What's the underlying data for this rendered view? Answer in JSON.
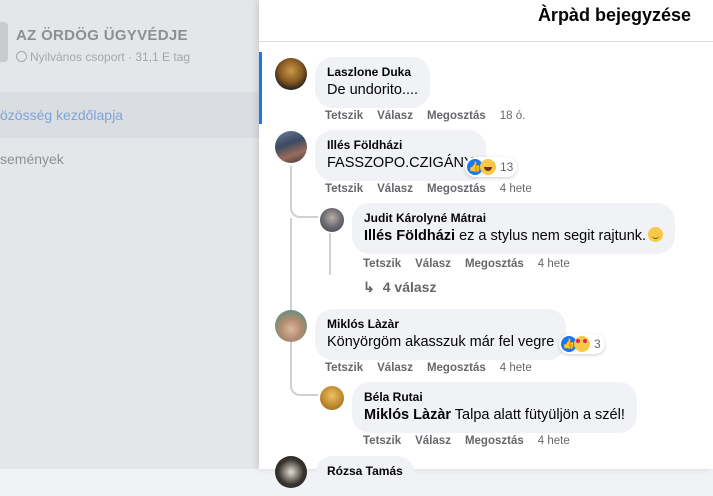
{
  "sidebar": {
    "group_name": "AZ ÖRDÖG ÜGYVÉDJE",
    "group_meta": "Nyilvános csoport · 31,1 E tag",
    "items": [
      {
        "label": "özösség kezdőlapja"
      },
      {
        "label": "semények"
      }
    ]
  },
  "panel": {
    "title": "Àrpàd bejegyzése"
  },
  "actions": {
    "like": "Tetszik",
    "reply": "Válasz",
    "share": "Megosztás"
  },
  "comments": [
    {
      "author": "Laszlone Duka",
      "text": "De undorito....",
      "time": "18 ó."
    },
    {
      "author": "Illés Földházi",
      "text": "FASSZOPO.CZIGÁNY",
      "time": "4 hete",
      "reaction_count": "13",
      "reactions": [
        "like-icon",
        "haha-icon"
      ]
    },
    {
      "author": "Judit Károlyné Mátrai",
      "mention": "Illés Földházi",
      "text": " ez a stylus nem segit rajtunk.",
      "time": "4 hete",
      "emoji": "upside-down-face-icon"
    },
    {
      "more_replies": "4 válasz"
    },
    {
      "author": "Miklós Làzàr",
      "text": "Könyörgöm akasszuk már fel vegre",
      "time": "4 hete",
      "reaction_count": "3",
      "reactions": [
        "like-icon",
        "love-icon"
      ]
    },
    {
      "author": "Béla Rutai",
      "mention": "Miklós Làzàr",
      "text": " Talpa alatt fütyüljön a szél!",
      "time": "4 hete"
    },
    {
      "author": "Rózsa Tamás"
    }
  ],
  "colors": {
    "accent": "#1877f2",
    "bubble": "#f0f2f5",
    "meta_text": "#65676b"
  }
}
